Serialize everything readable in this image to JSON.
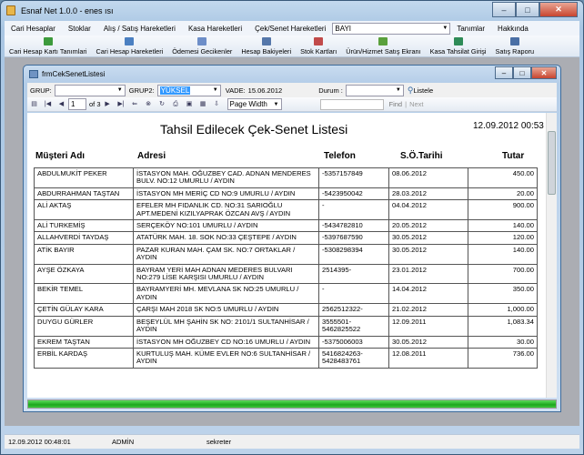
{
  "app": {
    "title": "Esnaf Net 1.0.0 - enes ısı",
    "accent": "#c3d9ee"
  },
  "window_buttons": {
    "minimize": "–",
    "maximize": "□",
    "close": "✕"
  },
  "menu": {
    "items": [
      "Cari Hesaplar",
      "Stoklar",
      "Alış / Satış Hareketleri",
      "Kasa Hareketleri",
      "Çek/Senet Hareketleri"
    ],
    "combo_value": "BAYI",
    "items_right": [
      "Tanımlar",
      "Hakkında"
    ]
  },
  "toolbar": {
    "items": [
      {
        "label": "Cari Hesap Kartı Tanımlari",
        "icon": "user-card-icon",
        "color": "#3c9a3c"
      },
      {
        "label": "Cari Hesap Hareketleri",
        "icon": "list-icon",
        "color": "#4a7fc1"
      },
      {
        "label": "Ödemesi Gecikenler",
        "icon": "clock-icon",
        "color": "#6d8ec8"
      },
      {
        "label": "Hesap Bakiyeleri",
        "icon": "balance-icon",
        "color": "#5577aa"
      },
      {
        "label": "Stok Kartları",
        "icon": "box-icon",
        "color": "#c14a4a"
      },
      {
        "label": "Ürün/Hizmet Satış Ekranı",
        "icon": "cart-icon",
        "color": "#5aa03c"
      },
      {
        "label": "Kasa Tahsilat Girişi",
        "icon": "cash-icon",
        "color": "#2e8b57"
      },
      {
        "label": "Satış Raporu",
        "icon": "report-icon",
        "color": "#4a6fa5"
      }
    ]
  },
  "child": {
    "title": "frmCekSenetListesi",
    "filter": {
      "grup_label": "GRUP:",
      "grup_value": "",
      "grup2_label": "GRUP2:",
      "grup2_value": "YÜKSEL",
      "vade_label": "VADE:",
      "vade_value": "15.06.2012",
      "durum_label": "Durum :",
      "durum_value": "",
      "list_button": "Listele"
    },
    "viewer": {
      "page_current": "1",
      "page_of": "of 3",
      "zoom": "Page Width",
      "find": "Find",
      "next": "Next"
    },
    "progress": 1.0
  },
  "report": {
    "title": "Tahsil Edilecek Çek-Senet Listesi",
    "date": "12.09.2012 00:53",
    "headers": {
      "customer": "Müşteri Adı",
      "address": "Adresi",
      "phone": "Telefon",
      "due": "S.Ö.Tarihi",
      "amount": "Tutar"
    },
    "rows": [
      {
        "customer": "ABDULMUKİT PEKER",
        "address": "İSTASYON MAH. OĞUZBEY CAD. ADNAN MENDERES BULV. NO:12 UMURLU / AYDIN",
        "phone": "-5357157849",
        "due": "08.06.2012",
        "amount": "450.00"
      },
      {
        "customer": "ABDURRAHMAN TAŞTAN",
        "address": "İSTASYON MH MERİÇ CD NO:9 UMURLU / AYDIN",
        "phone": "-5423950042",
        "due": "28.03.2012",
        "amount": "20.00"
      },
      {
        "customer": "ALİ AKTAŞ",
        "address": "EFELER MH FIDANLIK CD. NO:31 SARIOĞLU APT.MEDENİ KIZILYAPRAK ÖZCAN AVŞ / AYDIN",
        "phone": "-",
        "due": "04.04.2012",
        "amount": "900.00"
      },
      {
        "customer": "ALİ TURKEMİŞ",
        "address": "SERÇEKÖY NO:101 UMURLU / AYDIN",
        "phone": "-5434782810",
        "due": "20.05.2012",
        "amount": "140.00"
      },
      {
        "customer": "ALLAHVERDİ TAYDAŞ",
        "address": "ATATÜRK MAH. 18. SOK NO:33 ÇEŞTEPE / AYDIN",
        "phone": "-5397687590",
        "due": "30.05.2012",
        "amount": "120.00"
      },
      {
        "customer": "ATİK BAYIR",
        "address": "PAZAR KURAN MAH. ÇAM SK. NO:7 ORTAKLAR / AYDIN",
        "phone": "-5308298394",
        "due": "30.05.2012",
        "amount": "140.00"
      },
      {
        "customer": "AYŞE ÖZKAYA",
        "address": "BAYRAM YERİ MAH ADNAN MEDERES BULVARI NO:279 LİSE KARŞISI UMURLU / AYDIN",
        "phone": "2514395-",
        "due": "23.01.2012",
        "amount": "700.00"
      },
      {
        "customer": "BEKİR TEMEL",
        "address": "BAYRAMYERİ MH. MEVLANA SK NO:25 UMURLU / AYDIN",
        "phone": "-",
        "due": "14.04.2012",
        "amount": "350.00"
      },
      {
        "customer": "ÇETİN GÜLAY KARA",
        "address": "ÇARŞI MAH 2018 SK NO:5 UMURLU / AYDIN",
        "phone": "2562512322-",
        "due": "21.02.2012",
        "amount": "1,000.00"
      },
      {
        "customer": "DUYGU GÜRLER",
        "address": "BEŞEYLÜL MH ŞAHİN SK NO: 2101/1 SULTANHİSAR / AYDIN",
        "phone": "3555501-5462825522",
        "due": "12.09.2011",
        "amount": "1,083.34"
      },
      {
        "customer": "EKREM TAŞTAN",
        "address": "İSTASYON MH OĞUZBEY CD NO:16 UMURLU / AYDIN",
        "phone": "-5375006003",
        "due": "30.05.2012",
        "amount": "30.00"
      },
      {
        "customer": "ERBİL KARDAŞ",
        "address": "KURTULUŞ MAH. KÜME EVLER NO:6 SULTANHİSAR / AYDIN",
        "phone": "5416824263-5428483761",
        "due": "12.08.2011",
        "amount": "736.00"
      }
    ]
  },
  "status": {
    "datetime": "12.09.2012 00:48:01",
    "user": "ADMİN",
    "role": "sekreter"
  }
}
